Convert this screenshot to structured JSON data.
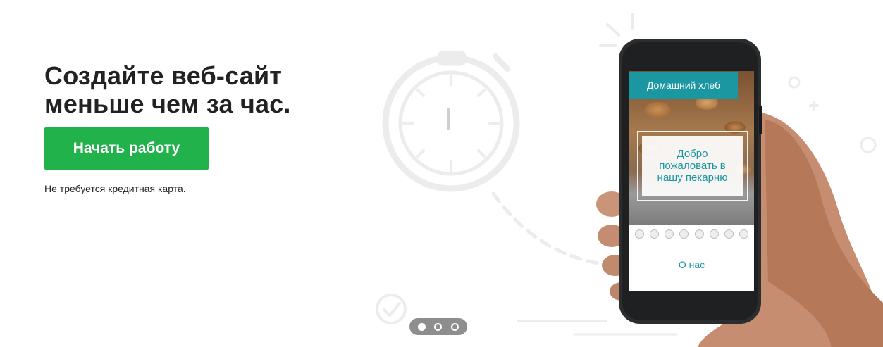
{
  "hero": {
    "headline_line1": "Создайте веб-сайт",
    "headline_line2": "меньше чем за час.",
    "cta_label": "Начать работу",
    "note": "Не требуется кредитная карта."
  },
  "phone": {
    "site_title": "Домашний хлеб",
    "welcome_text": "Добро\nпожаловать в\nнашу пекарню",
    "about_label": "О нас"
  },
  "pager": {
    "count": 3,
    "active_index": 0
  },
  "colors": {
    "cta": "#21b24b",
    "headline": "#222222",
    "teal": "#1b97a2",
    "decor": "#ebebeb",
    "pager_bg": "#8e8e8e"
  },
  "icons": [
    "stopwatch-icon",
    "checkmark-circle-icon",
    "sparkle-icon",
    "facebook-icon",
    "twitter-icon",
    "instagram-icon",
    "pinterest-icon",
    "linkedin-icon",
    "youtube-icon",
    "google-plus-icon",
    "email-icon"
  ]
}
